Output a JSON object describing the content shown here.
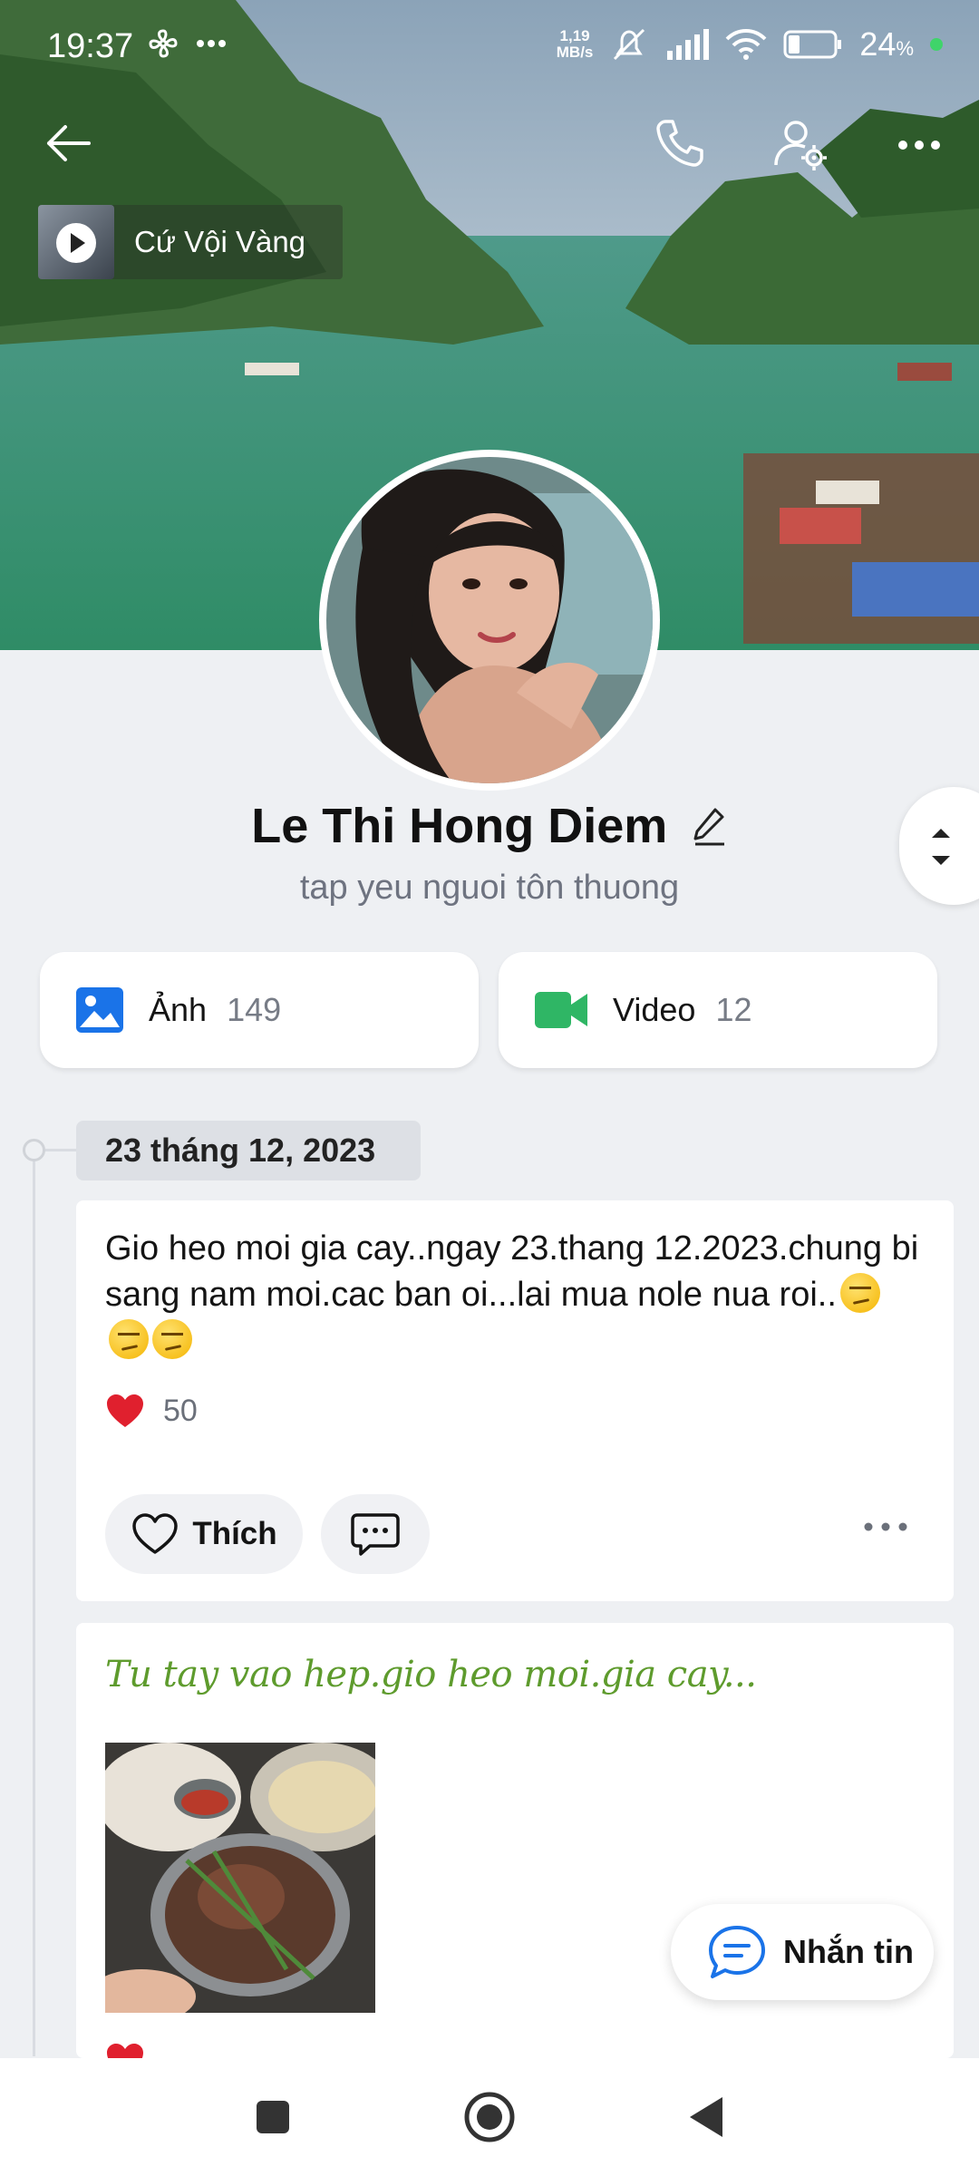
{
  "status_bar": {
    "time": "19:37",
    "network_speed_value": "1,19",
    "network_speed_unit": "MB/s",
    "battery": "24",
    "battery_unit": "%"
  },
  "header": {
    "music_title": "Cứ Vội Vàng"
  },
  "profile": {
    "name": "Le Thi Hong Diem",
    "bio": "tap yeu nguoi tôn thuong"
  },
  "media": {
    "photos_label": "Ảnh",
    "photos_count": "149",
    "videos_label": "Video",
    "videos_count": "12"
  },
  "timeline": {
    "date": "23 tháng 12, 2023"
  },
  "post1": {
    "text": "Gio heo moi gia cay..ngay 23.thang 12.2023.chung bi sang nam moi.cac ban oi...lai mua nole nua roi..",
    "reaction_count": "50",
    "like_label": "Thích"
  },
  "post2": {
    "title": "Tu tay vao hep.gio heo moi.gia cay..."
  },
  "message_button": {
    "label": "Nhắn tin"
  },
  "colors": {
    "accent_blue": "#1a73e8",
    "video_green": "#2fb665",
    "heart_red": "#e0202e",
    "title_green": "#5e9b2d"
  }
}
